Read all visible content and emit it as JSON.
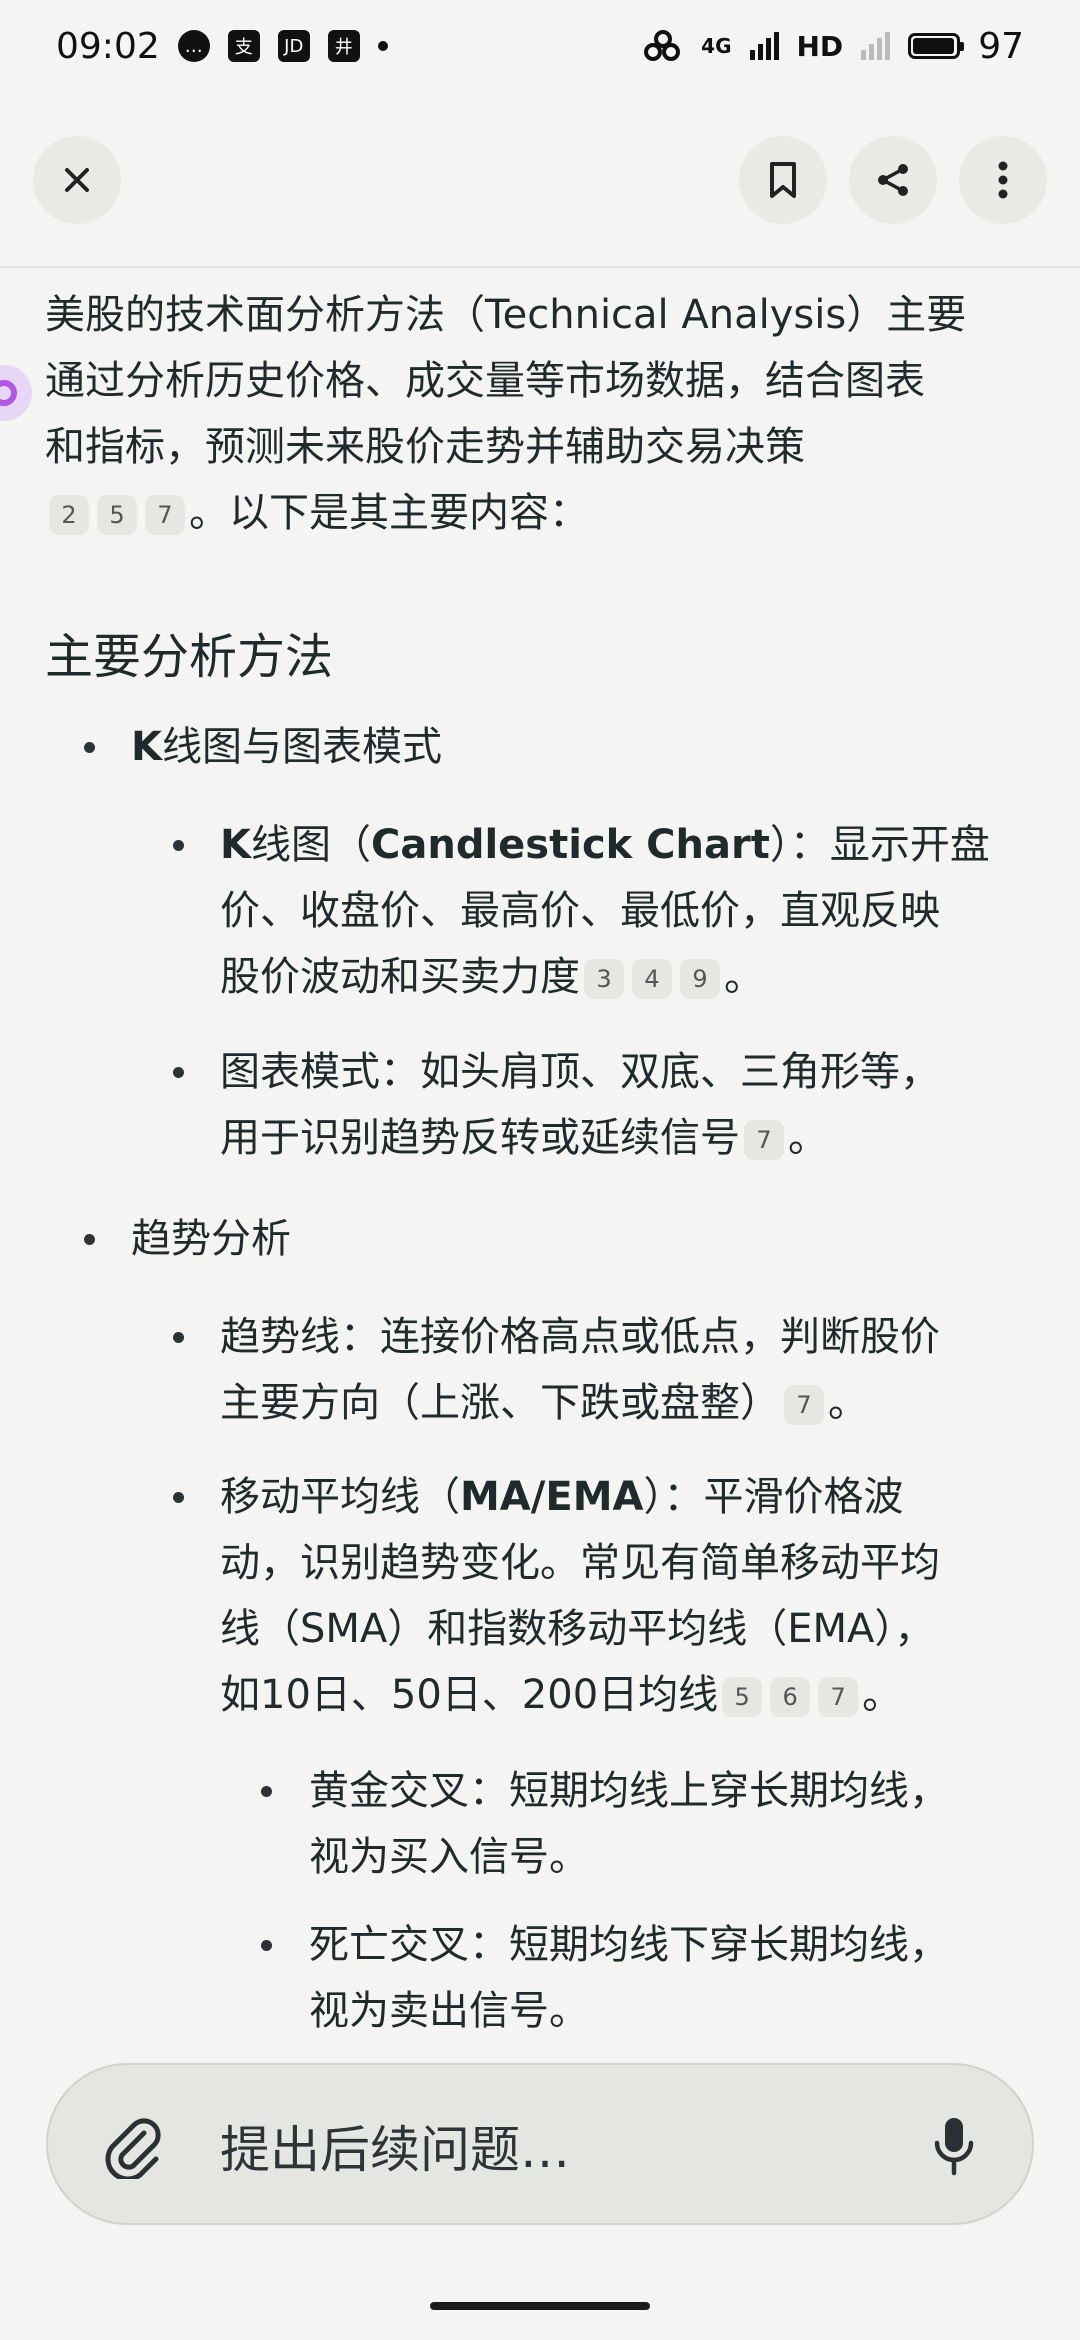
{
  "status_bar": {
    "time": "09:02",
    "apps": [
      "…",
      "支",
      "JD",
      "井"
    ],
    "network": "4G",
    "hd": "HD",
    "battery_level": "97",
    "battery_fraction": 0.97
  },
  "toolbar": {
    "close_icon": "close-icon",
    "bookmark_icon": "bookmark-icon",
    "share_icon": "share-icon",
    "more_icon": "more-vertical-icon"
  },
  "article": {
    "intro_l1": "美股的技术面分析方法（Technical Analysis）主要",
    "intro_l2": "通过分析历史价格、成交量等市场数据，结合图表",
    "intro_l3": "和指标，预测未来股价走势并辅助交易决策",
    "intro_cites": [
      "2",
      "5",
      "7"
    ],
    "intro_l4": "。以下是其主要内容：",
    "section_title": "主要分析方法",
    "b1_title_bold": "K",
    "b1_title_rest": "线图与图表模式",
    "b1a_l1_bold1": "K",
    "b1a_l1_mid": "线图（",
    "b1a_l1_bold2": "Candlestick Chart",
    "b1a_l1_rest": "）：显示开盘",
    "b1a_l2": "价、收盘价、最高价、最低价，直观反映",
    "b1a_l3": "股价波动和买卖力度",
    "b1a_cites": [
      "3",
      "4",
      "9"
    ],
    "b1a_end": "。",
    "b1b_l1": "图表模式：如头肩顶、双底、三角形等，",
    "b1b_l2": "用于识别趋势反转或延续信号",
    "b1b_cites": [
      "7"
    ],
    "b1b_end": "。",
    "b2_title": "趋势分析",
    "b2a_l1": "趋势线：连接价格高点或低点，判断股价",
    "b2a_l2": "主要方向（上涨、下跌或盘整）",
    "b2a_cites": [
      "7"
    ],
    "b2a_end": "。",
    "b2b_l1_pre": "移动平均线（",
    "b2b_l1_bold": "MA/EMA",
    "b2b_l1_rest": "）：平滑价格波",
    "b2b_l2": "动，识别趋势变化。常见有简单移动平均",
    "b2b_l3": "线（SMA）和指数移动平均线（EMA），",
    "b2b_l4": "如10日、50日、200日均线",
    "b2b_cites": [
      "5",
      "6",
      "7"
    ],
    "b2b_end": "。",
    "b2b1_l1": "黄金交叉：短期均线上穿长期均线，",
    "b2b1_l2": "视为买入信号。",
    "b2b2_l1": "死亡交叉：短期均线下穿长期均线，",
    "b2b2_l2": "视为卖出信号。"
  },
  "input_bar": {
    "placeholder": "提出后续问题…",
    "attach_icon": "paperclip-icon",
    "mic_icon": "microphone-icon"
  }
}
